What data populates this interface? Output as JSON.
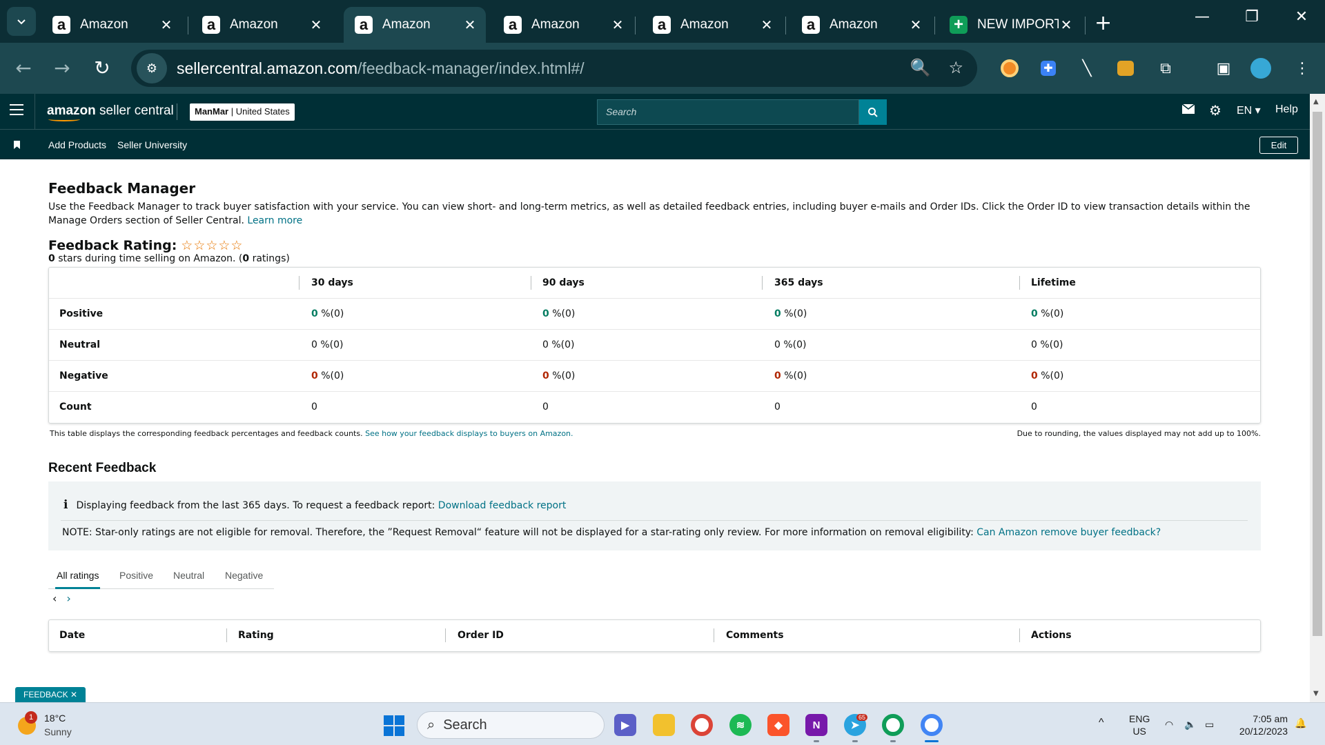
{
  "browser": {
    "tabs": [
      {
        "title": "Amazon",
        "icon": "a"
      },
      {
        "title": "Amazon",
        "icon": "a"
      },
      {
        "title": "Amazon",
        "icon": "a",
        "active": true
      },
      {
        "title": "Amazon",
        "icon": "a"
      },
      {
        "title": "Amazon",
        "icon": "a"
      },
      {
        "title": "Amazon",
        "icon": "a"
      },
      {
        "title": "NEW IMPORT",
        "icon": "+"
      }
    ],
    "url_host": "sellercentral.amazon.com",
    "url_path": "/feedback-manager/index.html#/"
  },
  "sc": {
    "logo_bold": "amazon",
    "logo_rest": " seller central",
    "store_bold": "ManMar",
    "store_rest": " | United States",
    "search_placeholder": "Search",
    "lang": "EN",
    "help": "Help",
    "bookmarks": [
      "Add Products",
      "Seller University"
    ],
    "edit": "Edit"
  },
  "fm": {
    "title": "Feedback Manager",
    "desc": "Use the Feedback Manager to track buyer satisfaction with your service. You can view short- and long-term metrics, as well as detailed feedback entries, including buyer e-mails and Order IDs. Click the Order ID to view transaction details within the Manage Orders section of Seller Central.",
    "learn_more": "Learn more",
    "rating_title": "Feedback Rating:",
    "stars": "☆☆☆☆☆",
    "rating_value": "0",
    "rating_sub_mid": " stars during time selling on Amazon. (",
    "rating_count": "0",
    "rating_sub_end": " ratings)"
  },
  "table": {
    "columns": [
      "30 days",
      "90 days",
      "365 days",
      "Lifetime"
    ],
    "rows": [
      {
        "label": "Positive",
        "cells": [
          "0",
          "0",
          "0",
          "0"
        ],
        "suffix": " %(0)",
        "tone": "g"
      },
      {
        "label": "Neutral",
        "cells": [
          "0",
          "0",
          "0",
          "0"
        ],
        "suffix": " %(0)",
        "tone": ""
      },
      {
        "label": "Negative",
        "cells": [
          "0",
          "0",
          "0",
          "0"
        ],
        "suffix": " %(0)",
        "tone": "r"
      },
      {
        "label": "Count",
        "cells": [
          "0",
          "0",
          "0",
          "0"
        ],
        "suffix": "",
        "tone": ""
      }
    ],
    "note_left": "This table displays the corresponding feedback percentages and feedback counts.",
    "note_left_link": "See how your feedback displays to buyers on Amazon.",
    "note_right": "Due to rounding, the values displayed may not add up to 100%."
  },
  "recent": {
    "title": "Recent Feedback",
    "info": "Displaying feedback from the last 365 days. To request a feedback report:",
    "info_link": "Download feedback report",
    "note": "NOTE: Star-only ratings are not eligible for removal. Therefore, the ”Request Removal“ feature will not be displayed for a star-rating only review. For more information on removal eligibility:",
    "note_link": "Can Amazon remove buyer feedback?",
    "tabs": [
      "All ratings",
      "Positive",
      "Neutral",
      "Negative"
    ],
    "columns": [
      "Date",
      "Rating",
      "Order ID",
      "Comments",
      "Actions"
    ]
  },
  "feedback_tag": "FEEDBACK ✕",
  "taskbar": {
    "badge": "1",
    "temp": "18°C",
    "cond": "Sunny",
    "search": "Search",
    "telegram_badge": "65",
    "lang1": "ENG",
    "lang2": "US",
    "time": "7:05 am",
    "date": "20/12/2023"
  },
  "colors": {
    "chrome_dark": "#0c2e35",
    "chrome_mid": "#1d4850",
    "sc_header": "#002f36",
    "link": "#007185",
    "positive": "#067d62",
    "negative": "#b12704"
  }
}
